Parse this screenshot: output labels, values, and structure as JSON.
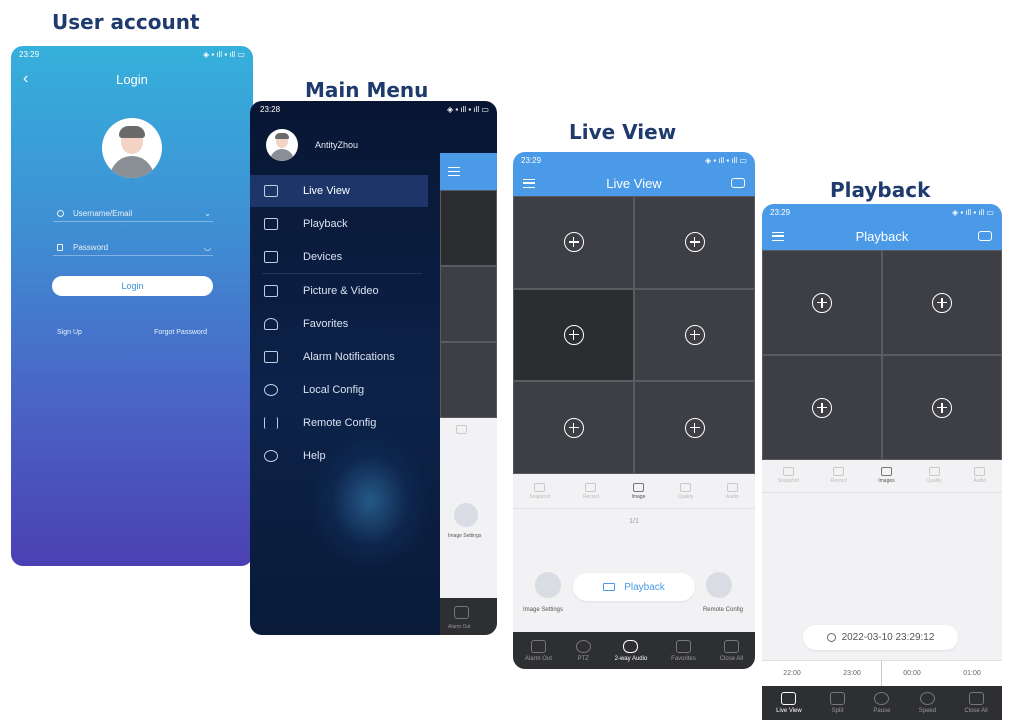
{
  "titles": {
    "user_account": "User account",
    "main_menu": "Main Menu",
    "live_view": "Live View",
    "playback": "Playback"
  },
  "colors": {
    "title_blue": "#1f3b6e",
    "app_blue": "#4a9ae8",
    "login_gradient_top": "#35a8d8",
    "login_gradient_bottom": "#4a3fb5",
    "menu_bg": "#0b1a3a",
    "cell_bg": "#3e3f44"
  },
  "login": {
    "time": "23:29",
    "title": "Login",
    "username_placeholder": "Username/Email",
    "password_placeholder": "Password",
    "login_button": "Login",
    "sign_up": "Sign Up",
    "forgot": "Forgot Password"
  },
  "menu": {
    "time": "23:28",
    "user": "AntityZhou",
    "items": [
      {
        "label": "Live View",
        "icon": "monitor-icon"
      },
      {
        "label": "Playback",
        "icon": "film-icon"
      },
      {
        "label": "Devices",
        "icon": "camera-icon"
      },
      {
        "label": "Picture & Video",
        "icon": "folder-icon"
      },
      {
        "label": "Favorites",
        "icon": "star-icon"
      },
      {
        "label": "Alarm Notifications",
        "icon": "alarm-icon"
      },
      {
        "label": "Local Config",
        "icon": "gear-icon"
      },
      {
        "label": "Remote Config",
        "icon": "sliders-icon"
      },
      {
        "label": "Help",
        "icon": "help-icon"
      }
    ],
    "peek_image_settings": "Image Settings",
    "peek_alarm_out": "Alarm Out"
  },
  "live": {
    "time": "23:29",
    "title": "Live View",
    "tools": [
      "Snapshot",
      "Record",
      "Image",
      "Quality",
      "Audio"
    ],
    "page_indicator": "1/1",
    "image_settings": "Image Settings",
    "playback_button": "Playback",
    "remote_config": "Remote Config",
    "bottom": [
      "Alarm Out",
      "PTZ",
      "2-way Audio",
      "Favorites",
      "Close All"
    ]
  },
  "playback": {
    "time": "23:29",
    "title": "Playback",
    "tools": [
      "Snapshot",
      "Record",
      "Images",
      "Quality",
      "Audio"
    ],
    "datetime": "2022-03-10 23:29:12",
    "timeline": [
      "22:00",
      "23:00",
      "00:00",
      "01:00"
    ],
    "bottom": [
      "Live View",
      "Split",
      "Pause",
      "Speed",
      "Close All"
    ]
  }
}
